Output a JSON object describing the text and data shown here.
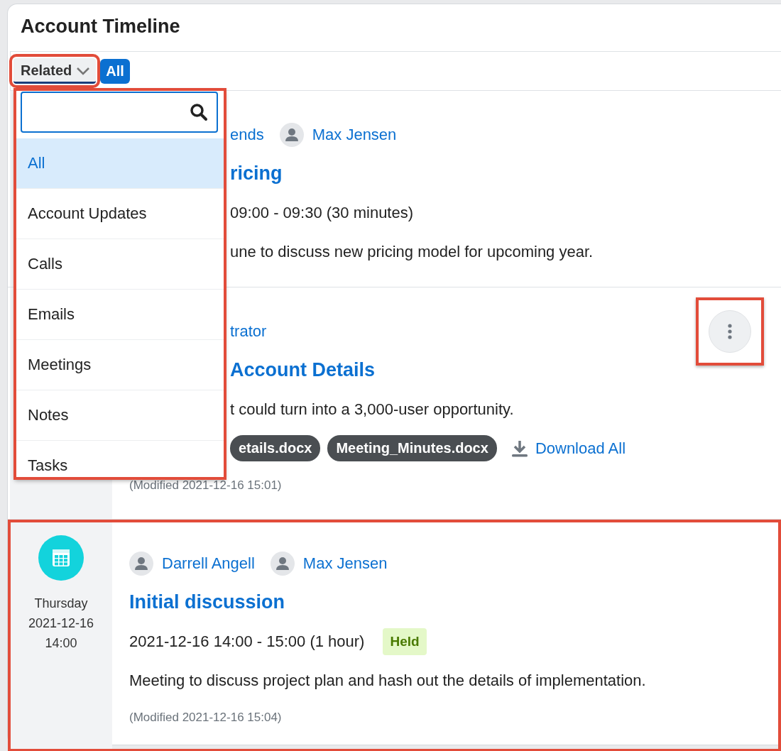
{
  "panel_title": "Account Timeline",
  "filter_bar": {
    "dropdown": {
      "label": "Related",
      "highlighted": true
    },
    "chips": [
      {
        "label": "All"
      }
    ]
  },
  "filter_menu": {
    "highlighted": true,
    "items": [
      {
        "label": "All",
        "selected": true
      },
      {
        "label": "Account Updates",
        "selected": false
      },
      {
        "label": "Calls",
        "selected": false
      },
      {
        "label": "Emails",
        "selected": false
      },
      {
        "label": "Meetings",
        "selected": false
      },
      {
        "label": "Notes",
        "selected": false
      },
      {
        "label": "Tasks",
        "selected": false
      }
    ]
  },
  "entries": [
    {
      "covered_by_menu": true,
      "highlighted": false,
      "people": [
        {
          "name": "ends",
          "avatar": false
        },
        {
          "name": "Max Jensen",
          "avatar": true
        }
      ],
      "title": "ricing",
      "time": "09:00 - 09:30 (30 minutes)",
      "description": "une to discuss new pricing model for upcoming year."
    },
    {
      "covered_by_menu": true,
      "highlighted": false,
      "actions_menu": {
        "highlighted": true
      },
      "people": [
        {
          "name": "trator",
          "avatar": false
        }
      ],
      "title": "Account Details",
      "description": "t could turn into a 3,000-user opportunity.",
      "attachments": [
        "etails.docx",
        "Meeting_Minutes.docx"
      ],
      "download_all": "Download All",
      "modified": "(Modified 2021-12-16 15:01)"
    },
    {
      "covered_by_menu": false,
      "highlighted": true,
      "stamp": {
        "day": "Thursday",
        "date": "2021-12-16",
        "time": "14:00"
      },
      "people": [
        {
          "name": "Darrell Angell",
          "avatar": true
        },
        {
          "name": "Max Jensen",
          "avatar": true
        }
      ],
      "title": "Initial discussion",
      "time": "2021-12-16 14:00 - 15:00 (1 hour)",
      "status": "Held",
      "description": "Meeting to discuss project plan and hash out the details of implementation.",
      "modified": "(Modified 2021-12-16 15:04)"
    }
  ]
}
